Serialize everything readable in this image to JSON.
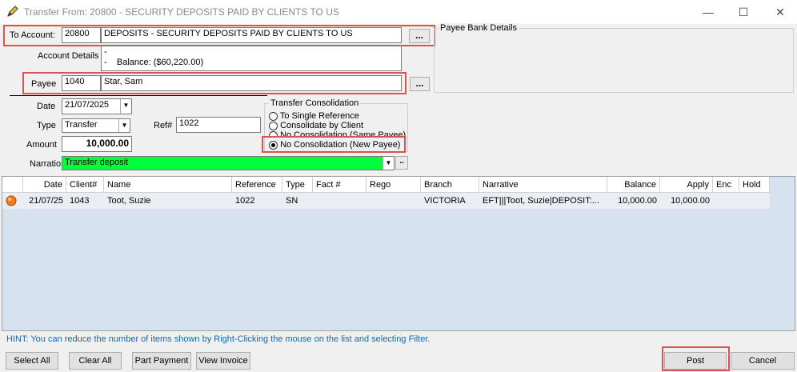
{
  "window": {
    "title": "Transfer From: 20800 - SECURITY DEPOSITS PAID BY CLIENTS TO US",
    "min": "—",
    "max": "☐",
    "close": "✕"
  },
  "to_account": {
    "label": "To Account:",
    "code": "20800",
    "name": "DEPOSITS - SECURITY DEPOSITS PAID BY CLIENTS TO US",
    "browse": "..."
  },
  "account_details": {
    "label": "Account Details",
    "line1": "-",
    "line2": "-    Balance: ($60,220.00)"
  },
  "payee": {
    "label": "Payee",
    "code": "1040",
    "name": "Star, Sam",
    "browse": "..."
  },
  "payee_bank": {
    "label": "Payee Bank Details"
  },
  "date": {
    "label": "Date",
    "value": "21/07/2025"
  },
  "type": {
    "label": "Type",
    "value": "Transfer"
  },
  "ref": {
    "label": "Ref#",
    "value": "1022"
  },
  "amount": {
    "label": "Amount",
    "value": "10,000.00"
  },
  "narration": {
    "label": "Narration",
    "value": "Transfer deposit",
    "browse": ".."
  },
  "consolidation": {
    "title": "Transfer Consolidation",
    "options": [
      "To Single Reference",
      "Consolidate by Client",
      "No Consolidation (Same Payee)",
      "No Consolidation (New Payee)"
    ],
    "selected": "No Consolidation (New Payee)"
  },
  "table": {
    "headers": [
      "Date",
      "Client#",
      "Name",
      "Reference",
      "Type",
      "Fact #",
      "Rego",
      "Branch",
      "Narrative",
      "Balance",
      "Apply",
      "Enc",
      "Hold"
    ],
    "rows": [
      {
        "date": "21/07/25",
        "client": "1043",
        "name": "Toot, Suzie",
        "reference": "1022",
        "type": "SN",
        "fact": "",
        "rego": "",
        "branch": "VICTORIA",
        "narrative": "EFT|||Toot, Suzie|DEPOSIT:...",
        "balance": "10,000.00",
        "apply": "10,000.00",
        "enc": "",
        "hold": ""
      }
    ]
  },
  "hint": "HINT: You can reduce the number of items shown by Right-Clicking the mouse on the list and selecting Filter.",
  "buttons": {
    "select_all": "Select All",
    "clear_all": "Clear All",
    "part_payment": "Part Payment",
    "view_invoice": "View Invoice",
    "post": "Post",
    "cancel": "Cancel"
  },
  "colors": {
    "narration_bg": "#00ff3a",
    "highlight": "#d9534f",
    "grid_bg": "#d6e2f0",
    "hint": "#1466b8"
  }
}
